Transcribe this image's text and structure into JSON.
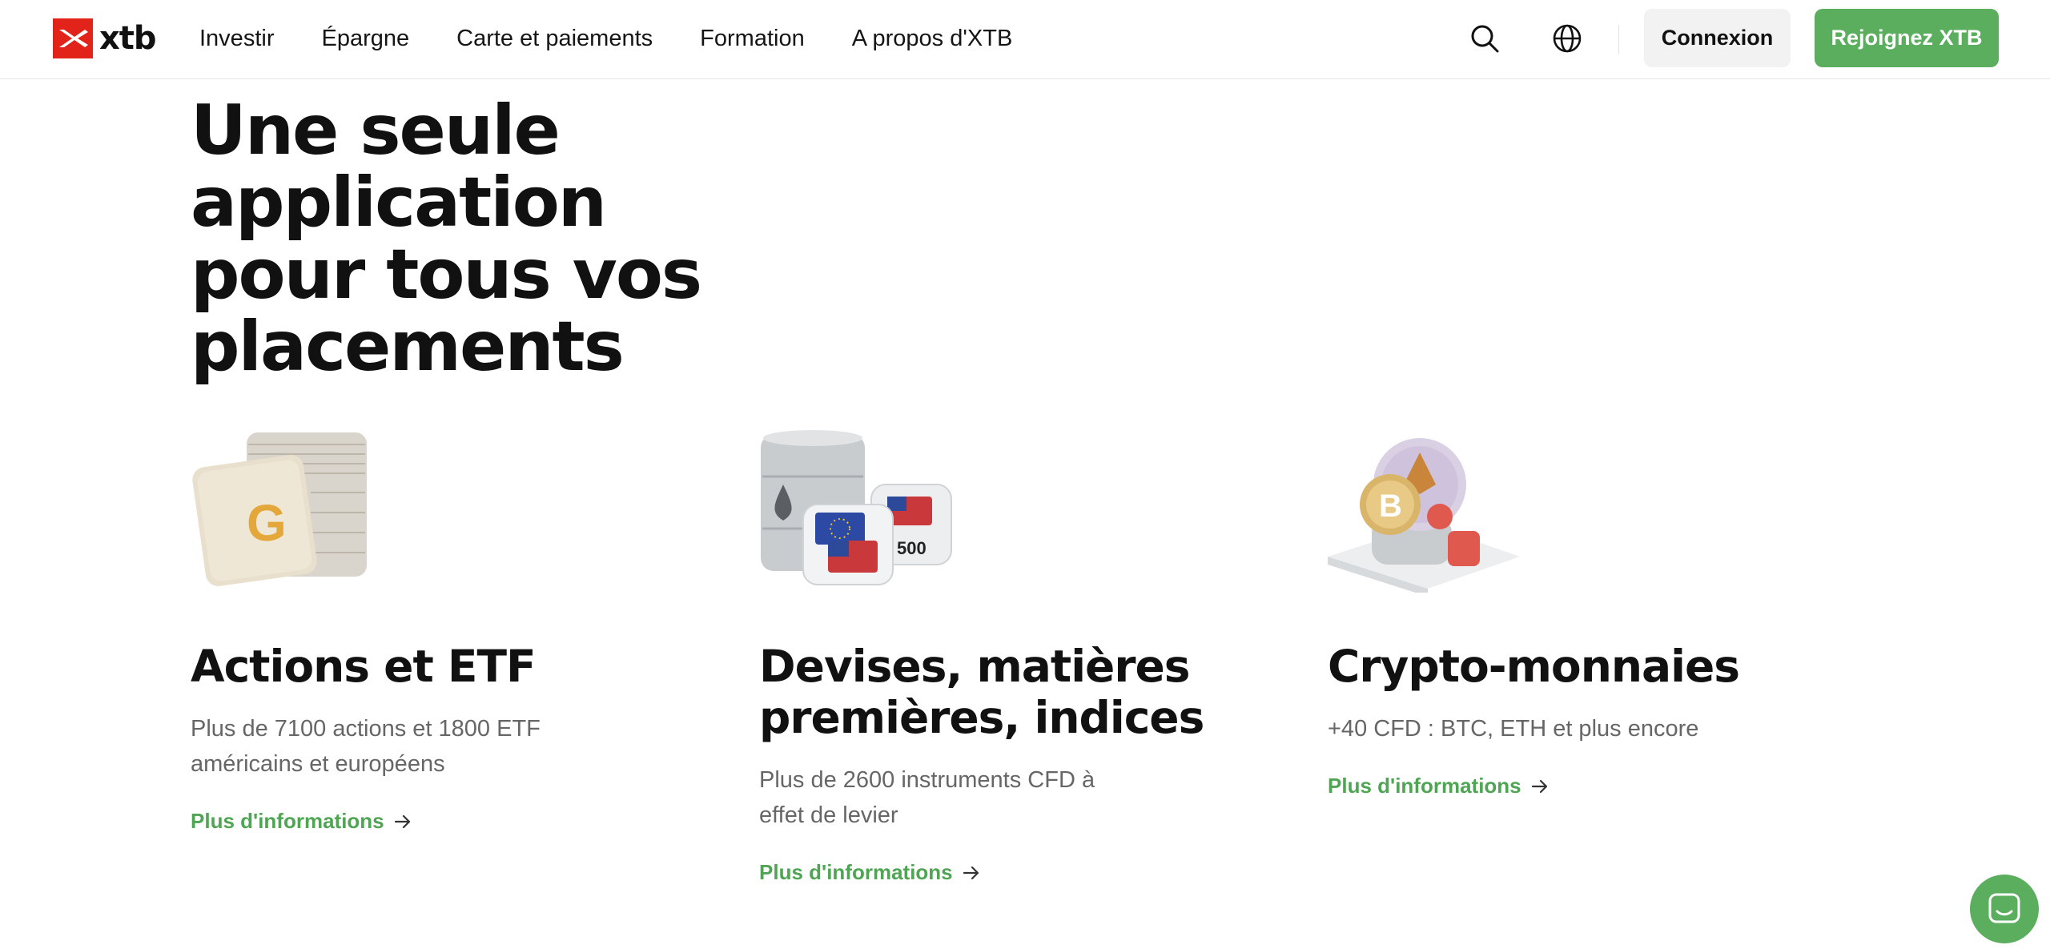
{
  "header": {
    "brand": "xtb",
    "nav": [
      "Investir",
      "Épargne",
      "Carte et paiements",
      "Formation",
      "A propos d'XTB"
    ],
    "login_label": "Connexion",
    "join_label": "Rejoignez XTB",
    "icons": [
      "search-icon",
      "globe-icon"
    ],
    "colors": {
      "brand_red": "#e2231a",
      "accent_green": "#5cae5f"
    }
  },
  "hero": {
    "title_lines": [
      "Une seule application",
      "pour tous vos",
      "placements"
    ]
  },
  "cards": [
    {
      "title_lines": [
        "Actions et ETF"
      ],
      "desc_lines": [
        "Plus de 7100 actions et 1800 ETF",
        "américains et européens"
      ],
      "link": "Plus d'informations",
      "illus_label": "G"
    },
    {
      "title_lines": [
        "Devises, matières",
        "premières, indices"
      ],
      "desc_lines": [
        "Plus de 2600 instruments CFD à",
        "effet de levier"
      ],
      "link": "Plus d'informations",
      "illus_label": "500"
    },
    {
      "title_lines": [
        "Crypto-monnaies"
      ],
      "desc_lines": [
        "+40 CFD : BTC, ETH et plus encore"
      ],
      "link": "Plus d'informations",
      "illus_label": "B"
    }
  ],
  "chat": {
    "icon": "chat-icon"
  }
}
